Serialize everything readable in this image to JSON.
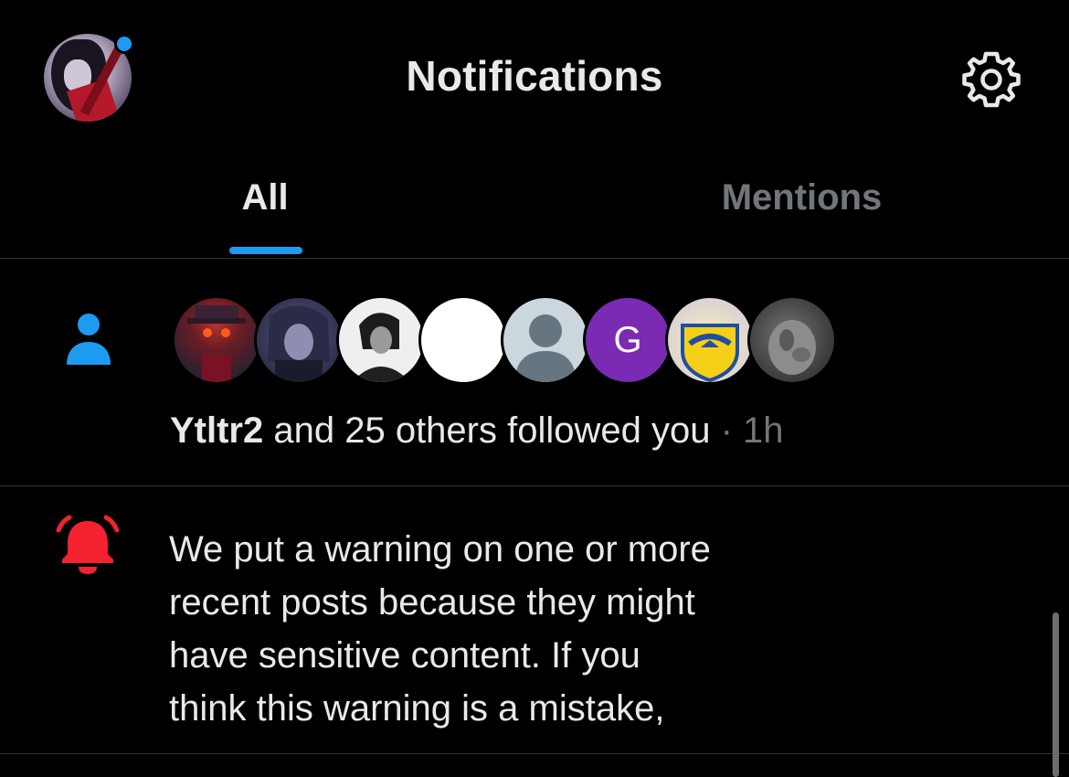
{
  "header": {
    "title": "Notifications",
    "profile_avatar_icon": "user-avatar",
    "settings_icon": "gear-icon"
  },
  "tabs": [
    {
      "label": "All",
      "active": true
    },
    {
      "label": "Mentions",
      "active": false
    }
  ],
  "notifications": [
    {
      "type": "follow",
      "icon": "person-icon",
      "avatars": [
        {
          "name": "follower-avatar-1"
        },
        {
          "name": "follower-avatar-2"
        },
        {
          "name": "follower-avatar-3"
        },
        {
          "name": "follower-avatar-4"
        },
        {
          "name": "follower-avatar-5-default"
        },
        {
          "name": "follower-avatar-6",
          "letter": "G"
        },
        {
          "name": "follower-avatar-7"
        },
        {
          "name": "follower-avatar-8"
        }
      ],
      "user": "Ytltr2",
      "text": " and 25 others followed you",
      "separator": " · ",
      "time": "1h"
    },
    {
      "type": "warning",
      "icon": "bell-icon",
      "lines": [
        "We put a warning on one or more",
        "recent posts because they might",
        "have sensitive content. If you",
        "think this warning is a mistake,"
      ]
    }
  ],
  "colors": {
    "accent": "#1d9bf0",
    "alert": "#f4212e",
    "muted": "#71767b",
    "text": "#e7e9ea",
    "background": "#000000"
  }
}
